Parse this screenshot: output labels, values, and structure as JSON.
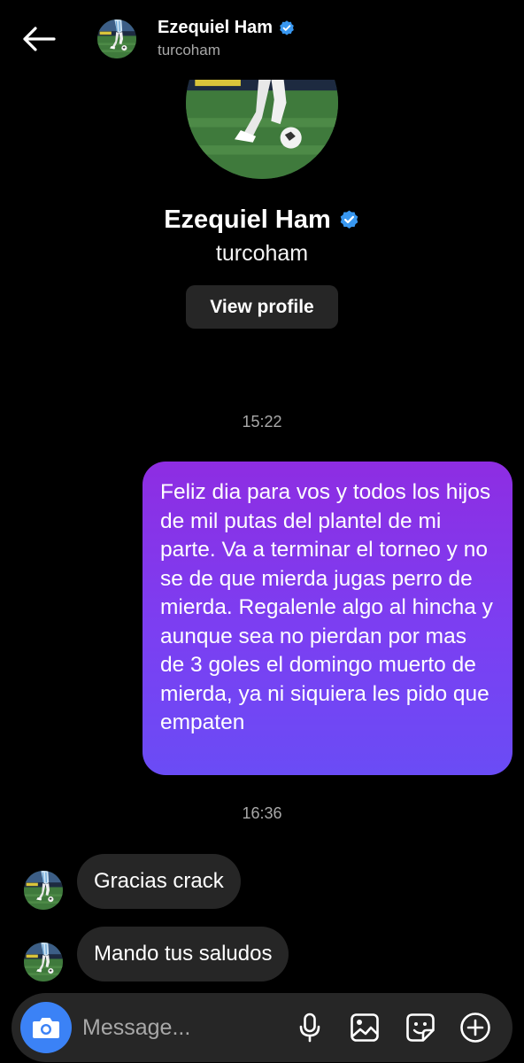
{
  "header": {
    "name": "Ezequiel Ham",
    "username": "turcoham",
    "back_icon": "arrow-left-icon",
    "verified_icon": "verified-badge-icon"
  },
  "profile": {
    "name": "Ezequiel Ham",
    "username": "turcoham",
    "view_profile_label": "View profile"
  },
  "messages": [
    {
      "time": "15:22"
    },
    {
      "direction": "outgoing",
      "text": "Feliz dia para vos y todos los hijos de mil putas del plantel de mi parte. Va a terminar el torneo y no se de que mierda jugas perro de mierda. Regalenle algo al hincha y aunque sea no pierdan por mas de 3 goles el domingo muerto de mierda, ya ni siquiera les pido que empaten"
    },
    {
      "time": "16:36"
    },
    {
      "direction": "incoming",
      "text": "Gracias crack"
    },
    {
      "direction": "incoming",
      "text": "Mando tus saludos"
    }
  ],
  "composer": {
    "placeholder": "Message...",
    "icons": [
      "camera-icon",
      "microphone-icon",
      "gallery-icon",
      "sticker-icon",
      "plus-icon"
    ]
  },
  "colors": {
    "background": "#000000",
    "bubble_incoming": "#262626",
    "bubble_outgoing_top": "#8e2de2",
    "bubble_outgoing_bottom": "#6a4cf5",
    "camera_button": "#3b82f6",
    "verified": "#3897f0"
  }
}
